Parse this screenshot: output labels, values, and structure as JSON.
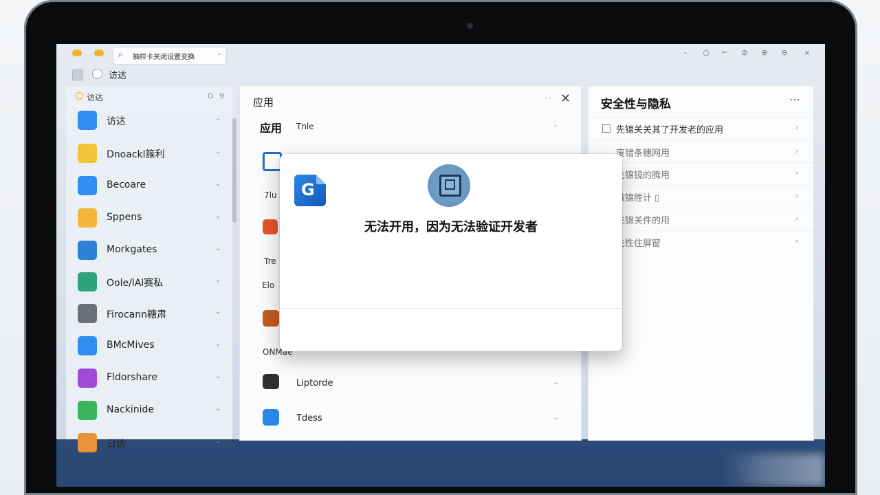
{
  "toolbar": {
    "search_text": "抽样卡关闭设置变换",
    "window_controls": [
      "–",
      "○",
      "⌐",
      "⊘",
      "⊕",
      "⊖",
      "×"
    ]
  },
  "row2": {
    "label": "访达"
  },
  "sidebar": {
    "header": {
      "label": "访达",
      "g": "G",
      "n": "9"
    },
    "items": [
      {
        "label": "访达",
        "icon": "folder-icon",
        "color": "#2f8ef0"
      },
      {
        "label": "Dnoackl簇利",
        "icon": "notes-icon",
        "color": "#f3c33a"
      },
      {
        "label": "Becoare",
        "icon": "folder-icon",
        "color": "#2f8ef0"
      },
      {
        "label": "Sppens",
        "icon": "notes-icon",
        "color": "#f5b53a"
      },
      {
        "label": "Morkgates",
        "icon": "window-icon",
        "color": "#2d82d8"
      },
      {
        "label": "Oole/lAl赛私",
        "icon": "screen-icon",
        "color": "#2fa37a"
      },
      {
        "label": "Firocann糖肃",
        "icon": "gear-icon",
        "color": "#6b7077"
      },
      {
        "label": "BMcMives",
        "icon": "back-icon",
        "color": "#2f8ef0"
      },
      {
        "label": "Fldorshare",
        "icon": "podcast-icon",
        "color": "#a24ad8"
      },
      {
        "label": "Nackinide",
        "icon": "message-icon",
        "color": "#3bb55b"
      },
      {
        "label": "日访",
        "icon": "app-icon",
        "color": "#e8923a"
      }
    ]
  },
  "middle": {
    "title": "应用",
    "mini": "◦◦",
    "section_label": "应用",
    "section_sub": "Tnle",
    "rows": [
      {
        "label": "Liptorde",
        "icon": "grid-icon",
        "color": "#333"
      },
      {
        "label": "Tdess",
        "icon": "window-icon",
        "color": "#2a86e6"
      }
    ],
    "fragments": [
      "7lu",
      "Tre",
      "Elo",
      "ONMae"
    ]
  },
  "right": {
    "title": "安全性与隐私",
    "items": [
      {
        "label": "先锦关关其了开发老的应用",
        "checkbox": true,
        "dim": false
      },
      {
        "label": "废错条穗网用",
        "checkbox": false,
        "dim": true
      },
      {
        "label": "先锦镜的腾用",
        "checkbox": false,
        "dim": true
      },
      {
        "label": "做锦胜计 ▯",
        "checkbox": false,
        "dim": true
      },
      {
        "label": "先锦关件的用",
        "checkbox": false,
        "dim": true
      },
      {
        "label": "先性住屏窗",
        "checkbox": false,
        "dim": true
      }
    ]
  },
  "modal": {
    "message": "无法开用，因为无法验证开发者"
  }
}
